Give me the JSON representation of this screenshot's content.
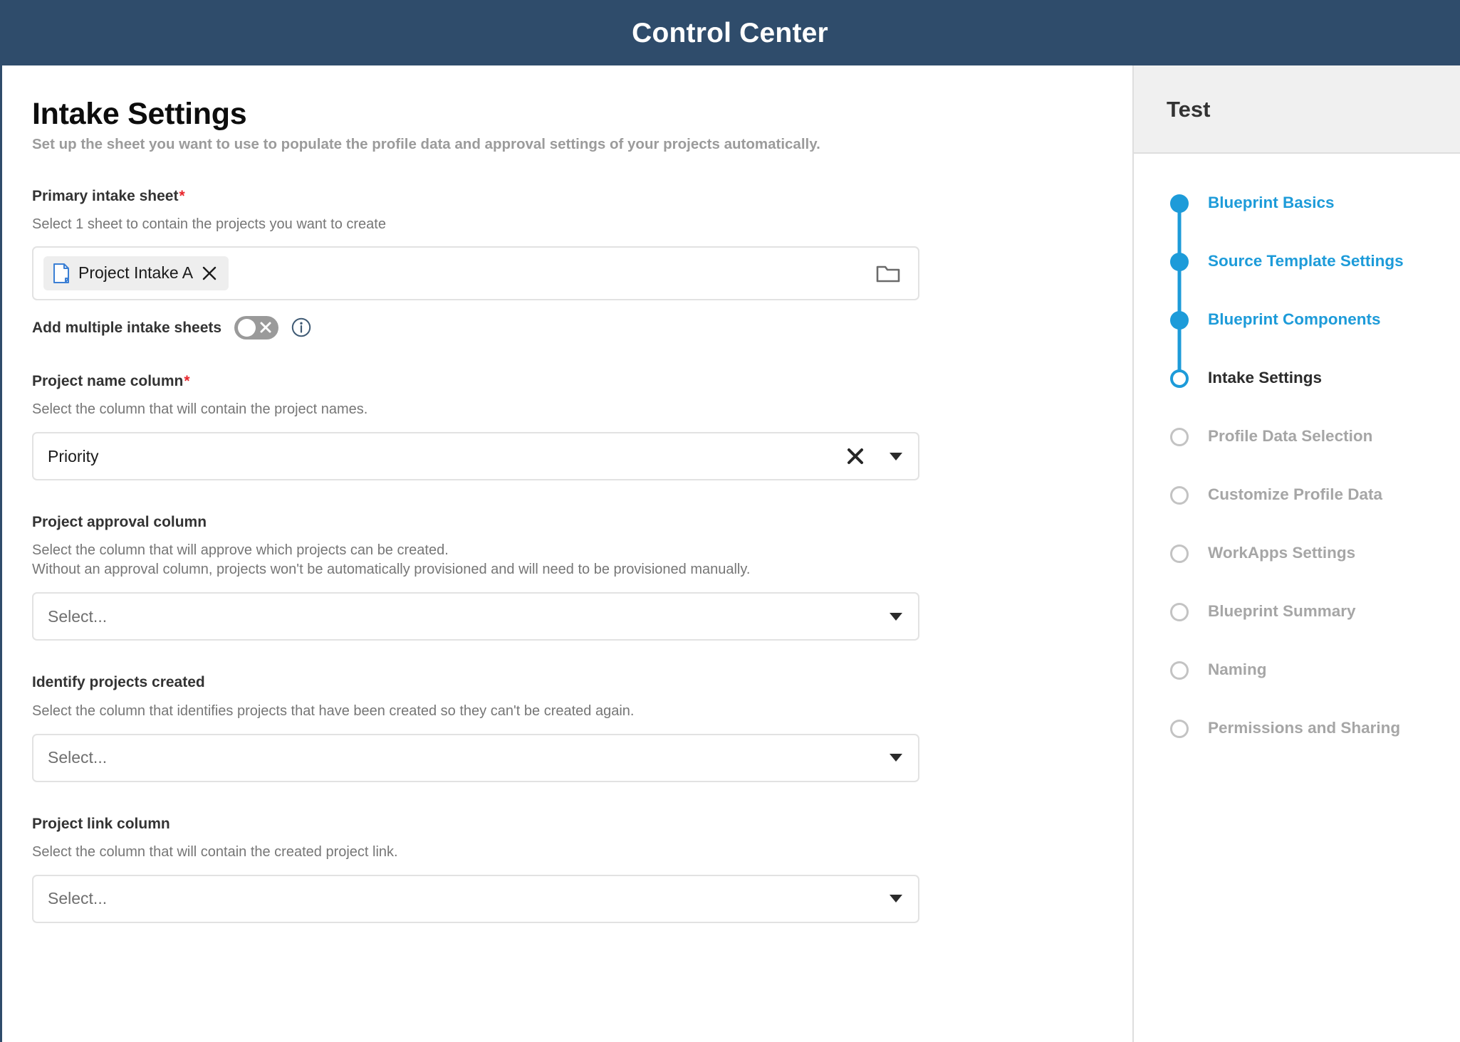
{
  "titlebar": {
    "title": "Control Center"
  },
  "page": {
    "title": "Intake Settings",
    "subtitle": "Set up the sheet you want to use to populate the profile data and approval settings of your projects automatically."
  },
  "colors": {
    "header_bg": "#2f4c6b",
    "accent_blue": "#1d9bd9",
    "required_red": "#e8262c",
    "muted_gray": "#9b9b9b",
    "sidebar_header_bg": "#f0f0f0"
  },
  "primary_intake_sheet": {
    "label": "Primary intake sheet",
    "required_marker": "*",
    "help": "Select 1 sheet to contain the projects you want to create",
    "chip": {
      "label": "Project Intake A",
      "icon": "sheet-icon",
      "close_icon": "close-icon"
    },
    "browse_icon": "folder-icon"
  },
  "add_multiple": {
    "label": "Add multiple intake sheets",
    "toggle_state": "off",
    "toggle_glyph": "x-mark",
    "info_icon": "info-icon"
  },
  "project_name_column": {
    "label": "Project name column",
    "required_marker": "*",
    "help": "Select the column that will contain the project names.",
    "value": "Priority",
    "clear_icon": "clear-x-icon",
    "caret_icon": "chevron-down-icon"
  },
  "project_approval_column": {
    "label": "Project approval column",
    "help_line1": "Select the column that will approve which projects can be created.",
    "help_line2": "Without an approval column, projects won't be automatically provisioned and will need to be provisioned manually.",
    "placeholder": "Select...",
    "caret_icon": "chevron-down-icon"
  },
  "identify_projects_created": {
    "label": "Identify projects created",
    "help": "Select the column that identifies projects that have been created so they can't be created again.",
    "placeholder": "Select...",
    "caret_icon": "chevron-down-icon"
  },
  "project_link_column": {
    "label": "Project link column",
    "help": "Select the column that will contain the created project link.",
    "placeholder": "Select...",
    "caret_icon": "chevron-down-icon"
  },
  "sidebar": {
    "blueprint_name": "Test",
    "steps": [
      {
        "label": "Blueprint Basics",
        "state": "done"
      },
      {
        "label": "Source Template Settings",
        "state": "done"
      },
      {
        "label": "Blueprint Components",
        "state": "done"
      },
      {
        "label": "Intake Settings",
        "state": "current"
      },
      {
        "label": "Profile Data Selection",
        "state": "todo"
      },
      {
        "label": "Customize Profile Data",
        "state": "todo"
      },
      {
        "label": "WorkApps Settings",
        "state": "todo"
      },
      {
        "label": "Blueprint Summary",
        "state": "todo"
      },
      {
        "label": "Naming",
        "state": "todo"
      },
      {
        "label": "Permissions and Sharing",
        "state": "todo"
      }
    ]
  }
}
